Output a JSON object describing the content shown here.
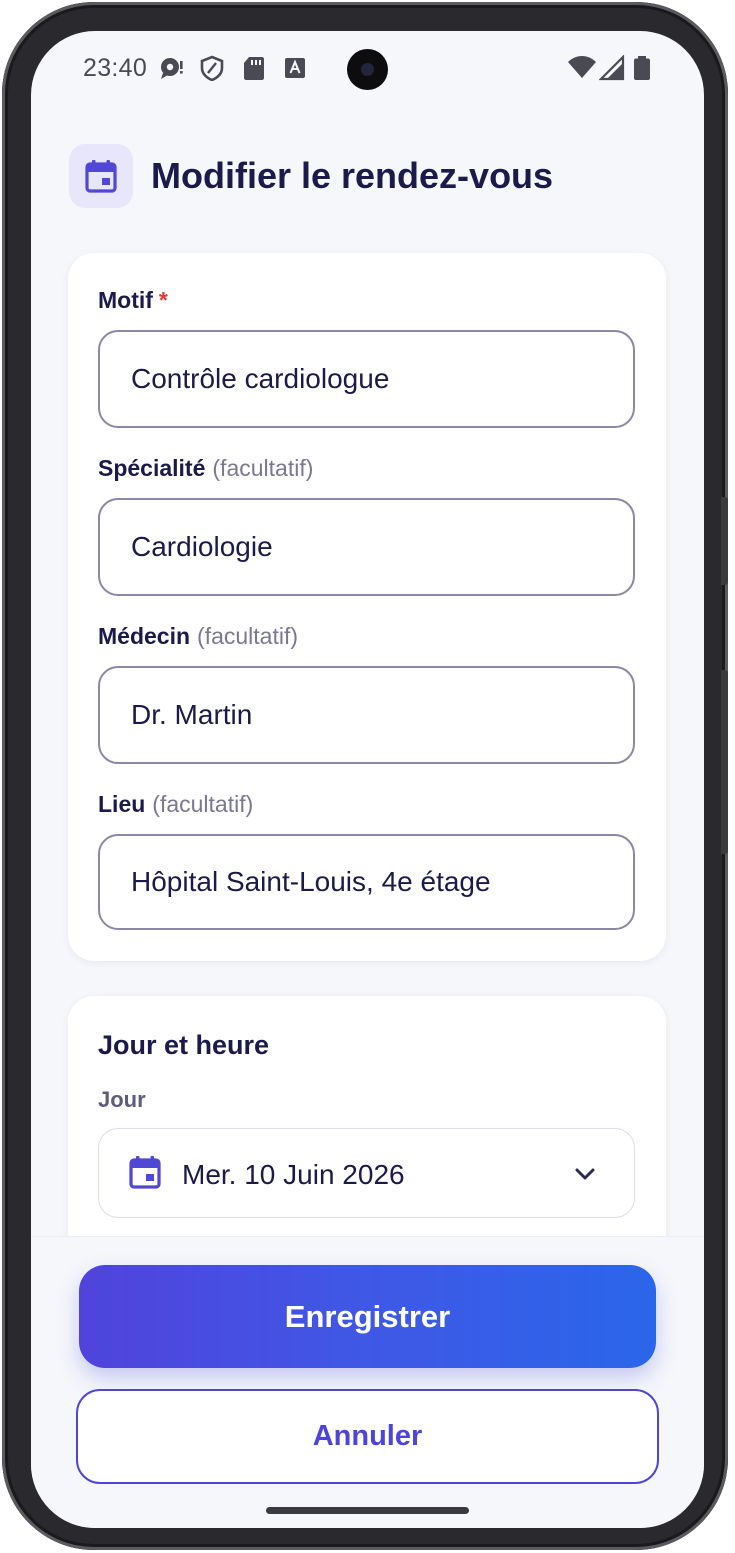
{
  "status_bar": {
    "time": "23:40",
    "left_icons": [
      "chat-bubble-icon",
      "shield-icon",
      "sd-card-icon",
      "keyboard-a-icon"
    ],
    "right_icons": [
      "wifi-icon",
      "signal-icon",
      "battery-icon"
    ]
  },
  "header": {
    "icon": "calendar-icon",
    "title": "Modifier le rendez-vous"
  },
  "details_card": {
    "fields": [
      {
        "label": "Motif",
        "required_mark": "*",
        "optional_text": "",
        "value": "Contrôle cardiologue"
      },
      {
        "label": "Spécialité",
        "required_mark": "",
        "optional_text": "(facultatif)",
        "value": "Cardiologie"
      },
      {
        "label": "Médecin",
        "required_mark": "",
        "optional_text": "(facultatif)",
        "value": "Dr. Martin"
      },
      {
        "label": "Lieu",
        "required_mark": "",
        "optional_text": "(facultatif)",
        "value": "Hôpital Saint-Louis, 4e étage"
      }
    ]
  },
  "datetime_card": {
    "title": "Jour et heure",
    "day_label": "Jour",
    "day_value": "Mer. 10 Juin 2026",
    "day_icon": "calendar-icon",
    "dropdown_icon": "chevron-down-icon"
  },
  "actions": {
    "save_label": "Enregistrer",
    "cancel_label": "Annuler"
  },
  "colors": {
    "primary": "#4e45d8",
    "gradient_start": "#5043dc",
    "gradient_end": "#2a66ea",
    "title_text": "#1c1a4a",
    "required": "#e53935",
    "background": "#f6f7fb"
  }
}
